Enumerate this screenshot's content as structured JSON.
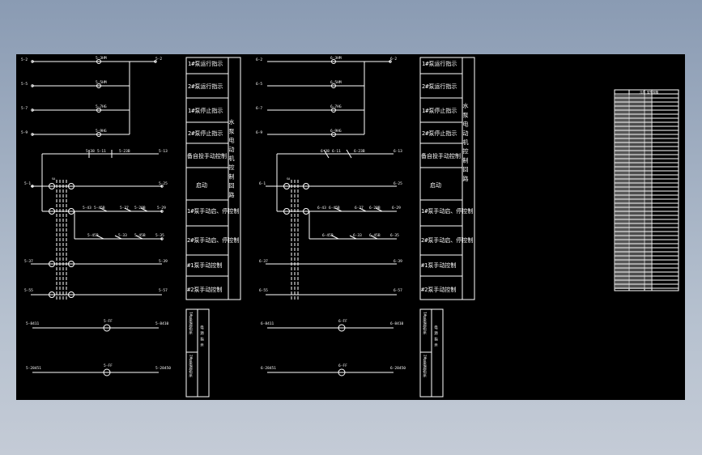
{
  "left_panel": {
    "wires": [
      {
        "l": "5-2",
        "m": "5-3HM",
        "r": "5-2"
      },
      {
        "l": "5-5",
        "m": "5-5HM",
        "r": ""
      },
      {
        "l": "5-7",
        "m": "5-7HG",
        "r": ""
      },
      {
        "l": "5-9",
        "m": "5-9HG",
        "r": ""
      }
    ],
    "bus": {
      "l": "5-38",
      "m1": "5-11",
      "m2": "5-23B",
      "r": "5-13"
    },
    "sw_top": {
      "l": "5-1",
      "r": "5-25"
    },
    "sw_row2": {
      "a": "5-43",
      "b": "5-45B",
      "c": "5-27",
      "d": "5-29B",
      "e": "5-29"
    },
    "sw_row3": {
      "a": "5-45B",
      "b": "5-33",
      "c": "5-45B",
      "d": "5-35"
    },
    "row4": {
      "l": "5-37",
      "r": "5-39"
    },
    "row5": {
      "l": "5-55",
      "r": "5-57"
    },
    "bottom1": {
      "l": "5-8411",
      "m": "5-FF",
      "r": "5-8410"
    },
    "bottom2": {
      "l": "5-28451",
      "m": "5-FF",
      "r": "5-28450"
    },
    "side_label": "水 泵 电 动 机 控 制 回 路",
    "bottom_side": "电 源 指 示"
  },
  "right_panel": {
    "wires": [
      {
        "l": "6-2",
        "m": "6-3HM",
        "r": "6-2"
      },
      {
        "l": "6-5",
        "m": "6-5HM",
        "r": ""
      },
      {
        "l": "6-7",
        "m": "6-7HG",
        "r": ""
      },
      {
        "l": "6-9",
        "m": "6-9HG",
        "r": ""
      }
    ],
    "bus": {
      "l": "6-38",
      "m1": "6-11",
      "m2": "6-23B",
      "r": "6-13"
    },
    "sw_top": {
      "l": "6-1",
      "r": "6-25"
    },
    "sw_row2": {
      "a": "6-43",
      "b": "6-45B",
      "c": "6-27",
      "d": "6-29B",
      "e": "6-29"
    },
    "sw_row3": {
      "a": "6-45B",
      "b": "6-33",
      "c": "6-45B",
      "d": "6-35"
    },
    "row4": {
      "l": "6-37",
      "r": "6-39"
    },
    "row5": {
      "l": "6-55",
      "r": "6-57"
    },
    "bottom1": {
      "l": "6-8411",
      "m": "6-FF",
      "r": "6-8410"
    },
    "bottom2": {
      "l": "6-28451",
      "m": "6-FF",
      "r": "6-28450"
    },
    "side_label": "水 泵 电 动 机 控 制 回 路",
    "bottom_side": "电 源 指 示"
  },
  "desc_boxes": [
    "1#泵运行指示",
    "2#泵运行指示",
    "1#泵停止指示",
    "2#泵停止指示",
    "备自投手动控制",
    "启动",
    "1#泵手动启、停控制",
    "2#泵手动启、停控制",
    "#1泵手动控制",
    "#2泵手动控制"
  ],
  "bottom_boxes": [
    "1#泵电源指示",
    "2#泵电源指示"
  ],
  "table_title": "元件 型号规格"
}
